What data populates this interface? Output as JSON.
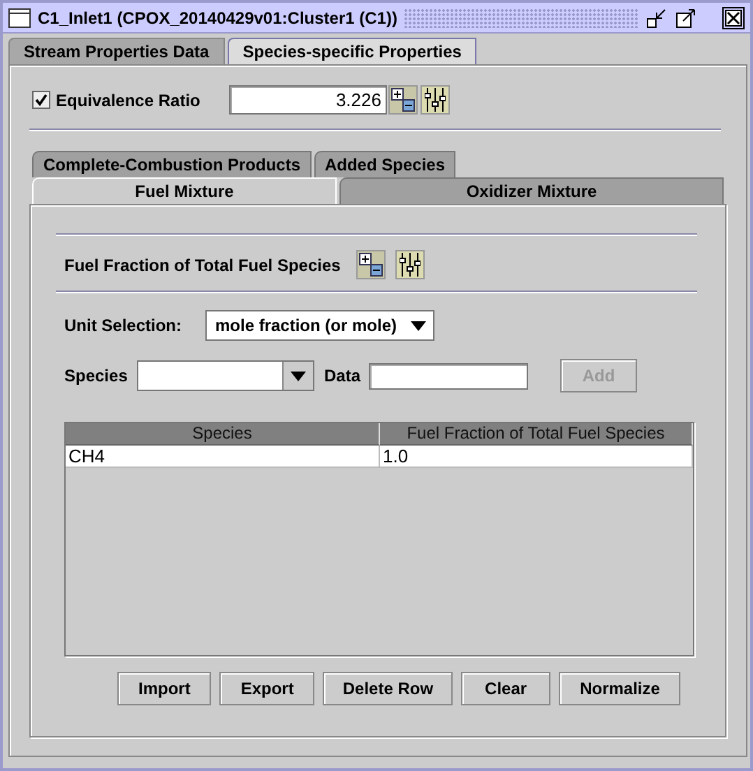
{
  "window": {
    "title": "C1_Inlet1  (CPOX_20140429v01:Cluster1 (C1))"
  },
  "tabs": [
    {
      "label": "Stream Properties Data",
      "selected": false
    },
    {
      "label": "Species-specific Properties",
      "selected": true
    }
  ],
  "equivalence_ratio": {
    "label": "Equivalence Ratio",
    "checked": true,
    "value": "3.226"
  },
  "mixture_tabs": {
    "back_row": [
      {
        "label": "Complete-Combustion Products",
        "selected": false
      },
      {
        "label": "Added Species",
        "selected": false
      }
    ],
    "front_row": [
      {
        "label": "Fuel Mixture",
        "selected": true
      },
      {
        "label": "Oxidizer Mixture",
        "selected": false
      }
    ]
  },
  "fuel_panel": {
    "heading": "Fuel Fraction of Total Fuel Species",
    "unit_label": "Unit Selection:",
    "unit_value": "mole fraction (or mole)",
    "species_label": "Species",
    "data_label": "Data",
    "add_button": {
      "label": "Add",
      "disabled": true
    }
  },
  "table": {
    "columns": [
      "Species",
      "Fuel Fraction of Total Fuel Species"
    ],
    "rows": [
      [
        "CH4",
        "1.0"
      ]
    ]
  },
  "buttons": [
    "Import",
    "Export",
    "Delete Row",
    "Clear",
    "Normalize"
  ]
}
